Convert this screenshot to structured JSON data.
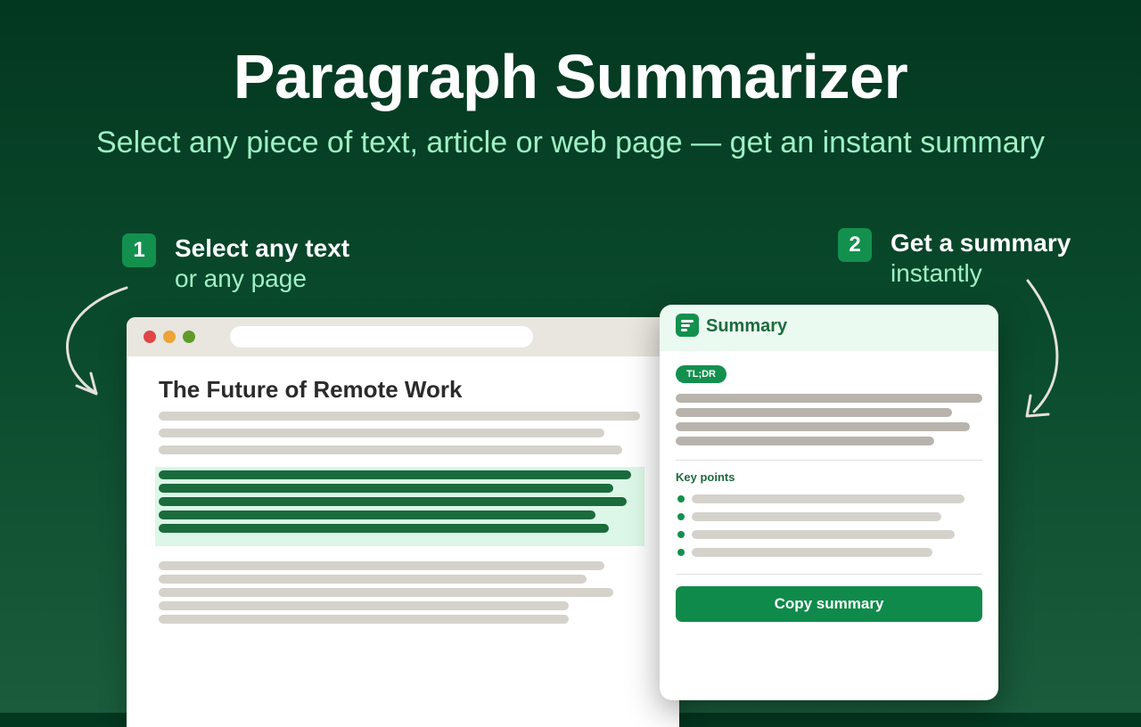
{
  "hero": {
    "title": "Paragraph Summarizer",
    "subtitle": "Select any piece of text, article or web page — get an instant summary"
  },
  "steps": [
    {
      "number": "1",
      "title": "Select any text",
      "subtitle": "or any page",
      "arrow_icon": "curved-arrow-icon"
    },
    {
      "number": "2",
      "title": "Get a summary",
      "subtitle": "instantly",
      "arrow_icon": "curved-arrow-icon"
    }
  ],
  "browser": {
    "window_controls": [
      "close",
      "minimize",
      "maximize"
    ],
    "article_title": "The Future of Remote Work"
  },
  "summary_card": {
    "title": "Summary",
    "icon": "summary-icon",
    "tldr_label": "TL;DR",
    "key_points_label": "Key points",
    "copy_button_label": "Copy summary"
  },
  "colors": {
    "background_top": "#033720",
    "background_bottom": "#1a5c3c",
    "accent": "#13904e",
    "highlight": "#dcf7e7",
    "subtitle_text": "#9ff0c6"
  }
}
